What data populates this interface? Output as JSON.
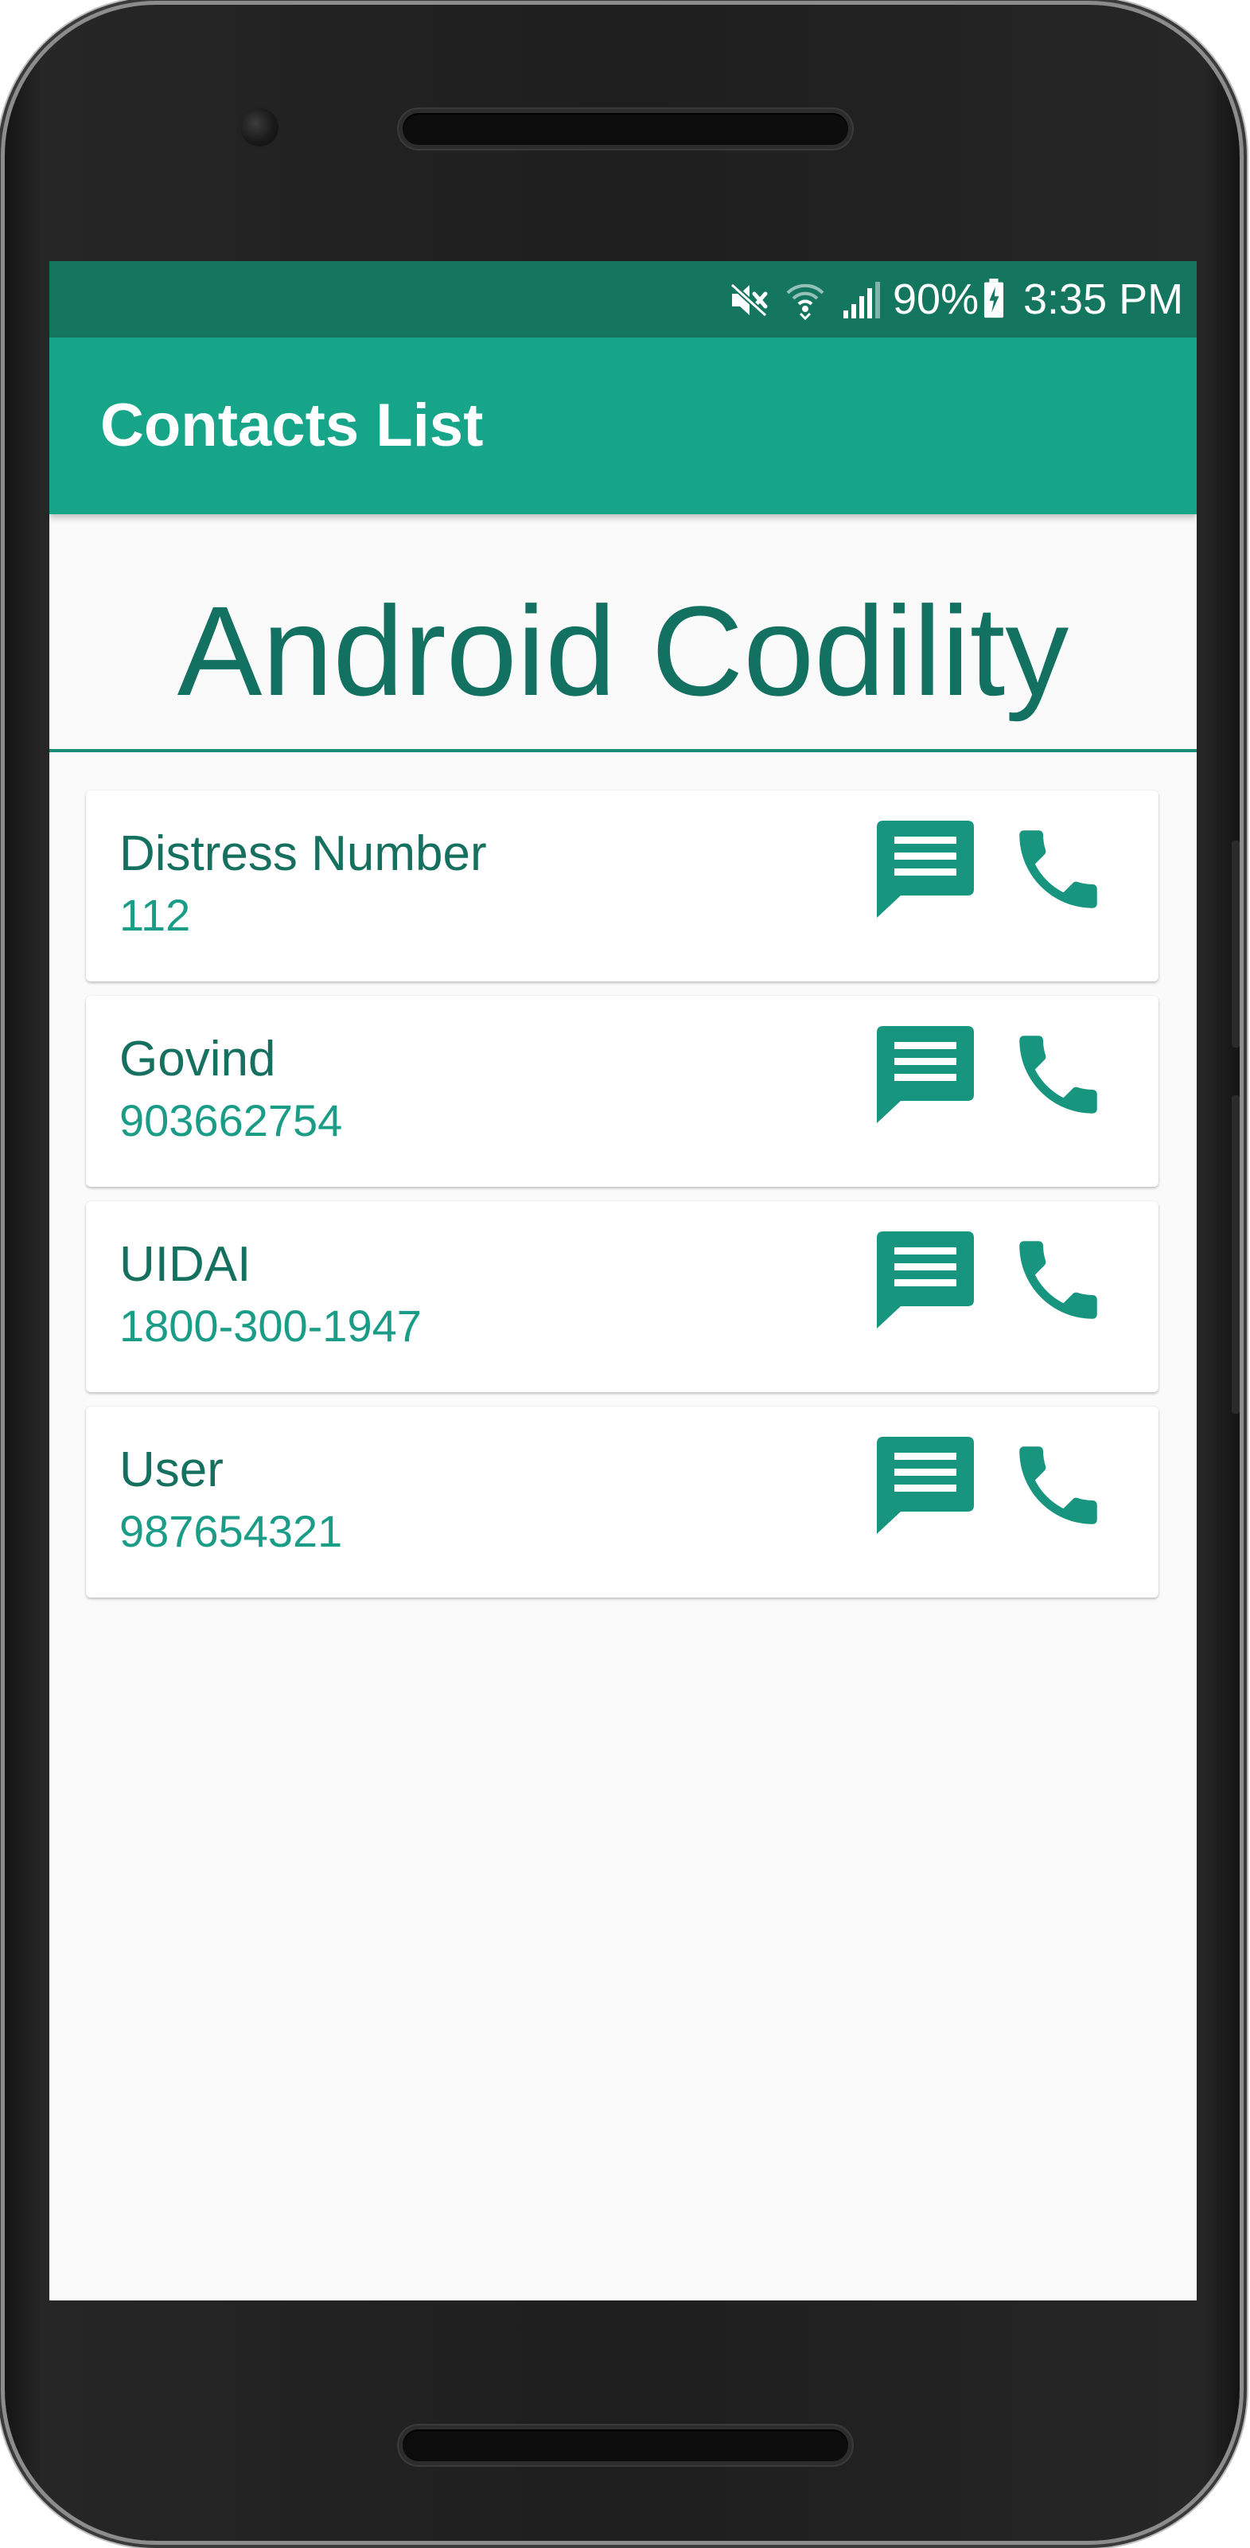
{
  "status_bar": {
    "battery": "90%",
    "time": "3:35 PM",
    "icons": [
      "mute-icon",
      "wifi-icon",
      "signal-icon",
      "battery-charging-icon"
    ]
  },
  "app_bar": {
    "title": "Contacts List"
  },
  "header": {
    "title": "Android Codility"
  },
  "contacts": [
    {
      "name": "Distress Number",
      "number": "112"
    },
    {
      "name": "Govind",
      "number": "903662754"
    },
    {
      "name": "UIDAI",
      "number": "1800-300-1947"
    },
    {
      "name": "User",
      "number": "987654321"
    }
  ],
  "actions": {
    "message_icon": "message-icon",
    "call_icon": "phone-icon"
  },
  "colors": {
    "status_bar": "#15765f",
    "app_bar": "#17a589",
    "accent_dark": "#137162",
    "accent": "#1a9c86",
    "background": "#fafafa"
  }
}
